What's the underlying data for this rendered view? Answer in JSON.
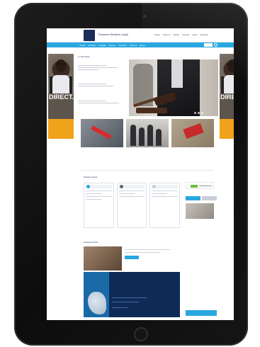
{
  "header": {
    "logo_text": "Thomson Reuters Legal",
    "top_links": [
      "About",
      "Careers",
      "Media",
      "Contact",
      "Login",
      "Register"
    ]
  },
  "nav": {
    "items": [
      "Topics",
      "Practice",
      "Insights",
      "Events",
      "Products",
      "Careers",
      "Blogs"
    ]
  },
  "side_ad": {
    "headline": "DIRECT.",
    "body": "",
    "cta": ""
  },
  "hero": {
    "section_label": "In This Issue",
    "items": [
      {
        "title": ""
      },
      {
        "title": ""
      },
      {
        "title": ""
      }
    ]
  },
  "thumbnails": {
    "captions": [
      {
        "title": "",
        "meta": ""
      },
      {
        "title": "",
        "meta": ""
      },
      {
        "title": "",
        "meta": ""
      }
    ]
  },
  "panels": {
    "section_label": "Practice Areas",
    "items": [
      {
        "text": ""
      },
      {
        "text": ""
      },
      {
        "text": ""
      }
    ]
  },
  "sidebar": {
    "title": "",
    "tabs": [
      "",
      ""
    ],
    "entries": [
      {
        "title": "",
        "meta": ""
      },
      {
        "title": "",
        "meta": ""
      },
      {
        "title": "",
        "meta": ""
      },
      {
        "title": "",
        "meta": ""
      }
    ],
    "bottom_button": ""
  },
  "featured": {
    "title": "Featured Posts",
    "card_title": "",
    "button": ""
  },
  "promo": {
    "title": "",
    "subtitle": ""
  },
  "colors": {
    "brand_navy": "#1b2e5a",
    "accent_blue": "#29a7df",
    "ad_orange": "#f0a21b"
  }
}
